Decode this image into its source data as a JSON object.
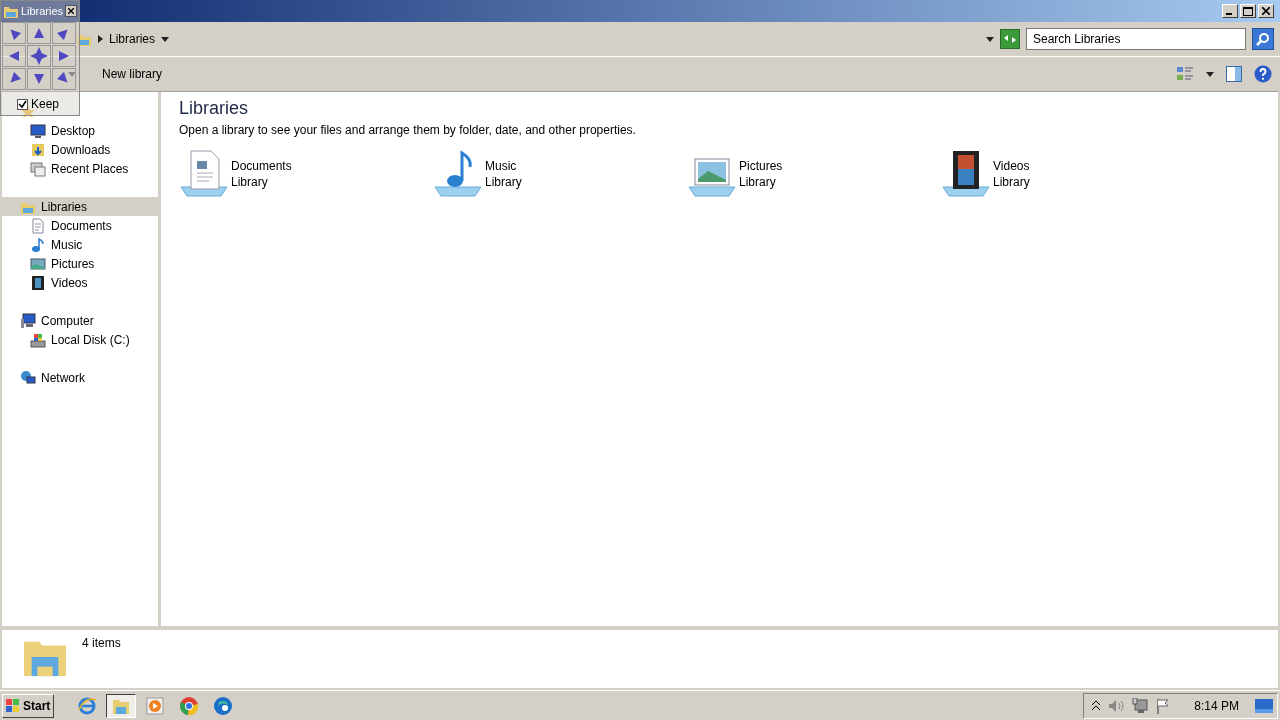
{
  "overlay": {
    "title": "Libraries",
    "keep": {
      "label": "Keep",
      "checked": true
    }
  },
  "address": {
    "breadcrumb": "Libraries"
  },
  "search": {
    "placeholder": "Search Libraries"
  },
  "toolbar": {
    "buttons": [
      {
        "kind": "menu"
      },
      {
        "label": "New library",
        "kind": "plain"
      }
    ]
  },
  "sidebar": {
    "groups": [
      {
        "kind": "star",
        "selected": false,
        "children": [
          {
            "label": "Desktop",
            "kind": "desktop",
            "selected": false
          },
          {
            "label": "Downloads",
            "kind": "downloads",
            "selected": false
          },
          {
            "label": "Recent Places",
            "kind": "recent",
            "selected": false
          }
        ]
      },
      {
        "label": "Libraries",
        "kind": "library",
        "selected": true,
        "children": [
          {
            "label": "Documents",
            "kind": "documents",
            "selected": false
          },
          {
            "label": "Music",
            "kind": "music",
            "selected": false
          },
          {
            "label": "Pictures",
            "kind": "pictures",
            "selected": false
          },
          {
            "label": "Videos",
            "kind": "videos",
            "selected": false
          }
        ]
      },
      {
        "label": "Computer",
        "kind": "computer",
        "selected": false,
        "children": [
          {
            "label": "Local Disk (C:)",
            "kind": "disk",
            "selected": false
          }
        ]
      },
      {
        "label": "Network",
        "kind": "network",
        "selected": false
      }
    ]
  },
  "content": {
    "title": "Libraries",
    "description": "Open a library to see your files and arrange them by folder, date, and other properties.",
    "libraries": [
      {
        "name": "Documents",
        "type": "Library",
        "kind": "documents"
      },
      {
        "name": "Music",
        "type": "Library",
        "kind": "music"
      },
      {
        "name": "Pictures",
        "type": "Library",
        "kind": "pictures"
      },
      {
        "name": "Videos",
        "type": "Library",
        "kind": "videos"
      }
    ]
  },
  "status": {
    "count": "4 items"
  },
  "taskbar": {
    "start": "Start",
    "apps": [
      {
        "kind": "ie",
        "selected": false
      },
      {
        "kind": "explorer",
        "selected": true
      },
      {
        "kind": "media",
        "selected": false
      },
      {
        "kind": "chrome",
        "selected": false
      },
      {
        "kind": "edge",
        "selected": false
      }
    ],
    "clock": "8:14 PM"
  }
}
